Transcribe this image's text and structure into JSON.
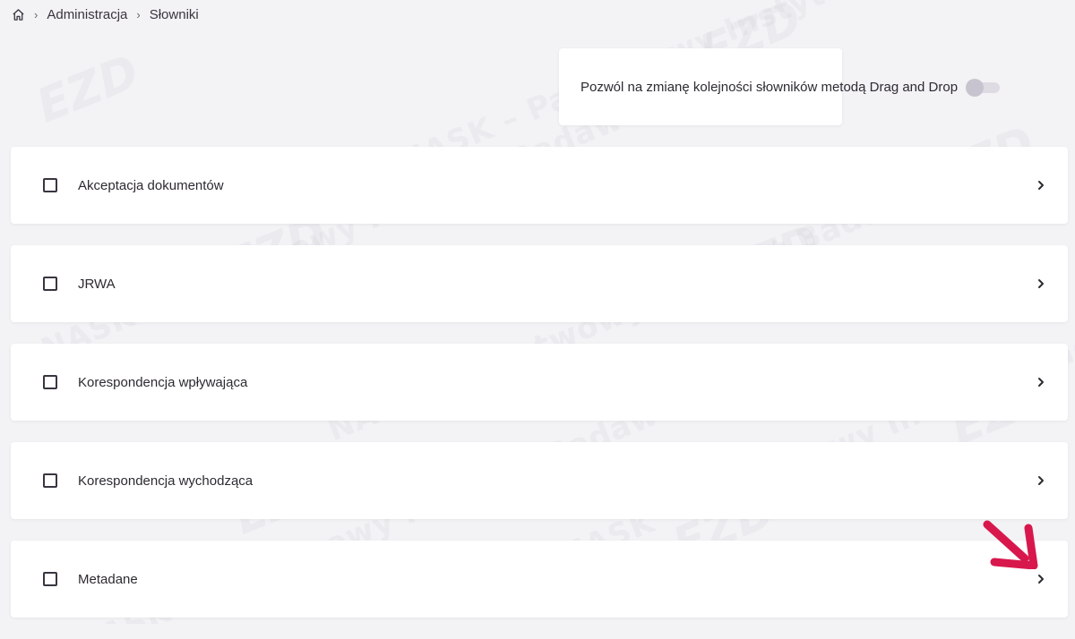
{
  "breadcrumb": {
    "home_icon": "home-icon",
    "items": [
      "Administracja",
      "Słowniki"
    ]
  },
  "dnd_toggle": {
    "label": "Pozwól na zmianę kolejności słowników metodą Drag and Drop",
    "enabled": false
  },
  "dictionaries": [
    {
      "label": "Akceptacja dokumentów",
      "checked": false
    },
    {
      "label": "JRWA",
      "checked": false
    },
    {
      "label": "Korespondencja wpływająca",
      "checked": false
    },
    {
      "label": "Korespondencja wychodząca",
      "checked": false
    },
    {
      "label": "Metadane",
      "checked": false
    }
  ],
  "watermark": {
    "logo": "EZD",
    "logo_sup": "RP",
    "org": "NASK",
    "text": "NASK – Państwowy Instytut Badawczy"
  },
  "colors": {
    "background": "#f3f2f5",
    "card": "#ffffff",
    "text": "#2d2a32",
    "toggle_track": "#dedbe3",
    "toggle_knob": "#c8c4cf",
    "annotation_arrow": "#d8184d"
  }
}
